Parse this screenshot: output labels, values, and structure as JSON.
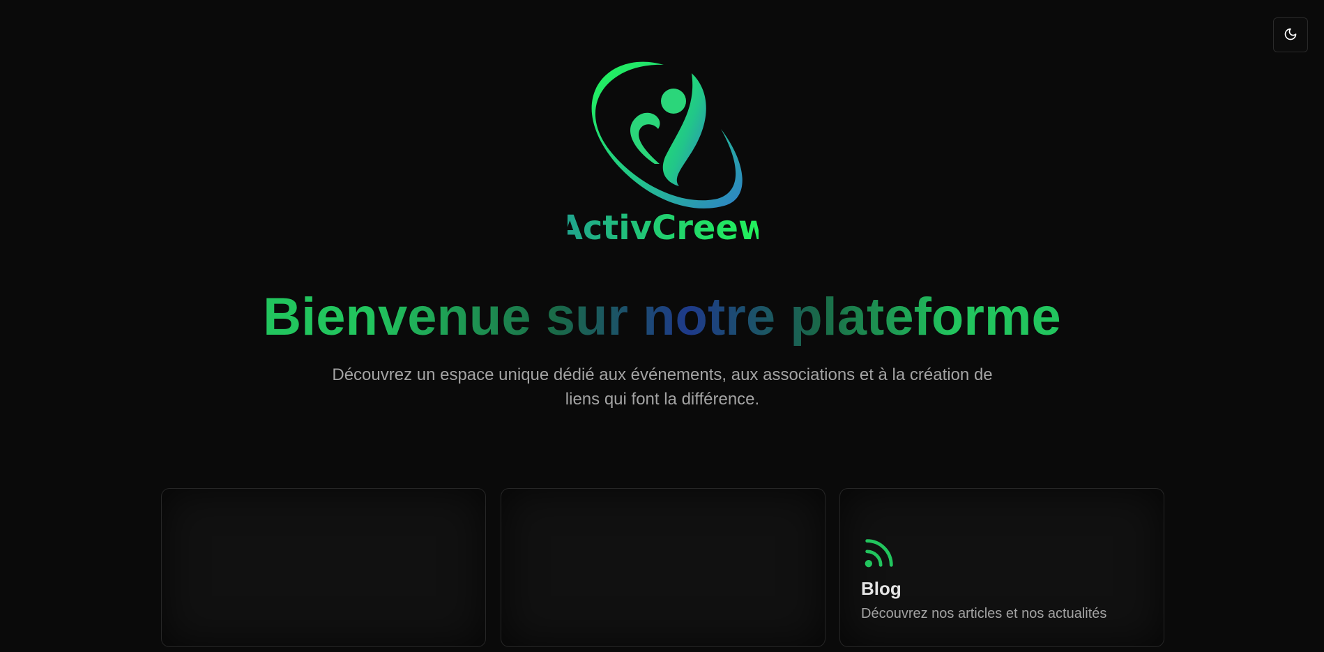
{
  "theme_toggle": {
    "icon": "moon-icon",
    "color": "#ffffff"
  },
  "logo": {
    "wordmark": "ActivCreew",
    "primary_color": "#22c55e",
    "secondary_color": "#2f80c8"
  },
  "hero": {
    "title": "Bienvenue sur notre plateforme",
    "subtitle": "Découvrez un espace unique dédié aux événements, aux associations et à la création de liens qui font la différence."
  },
  "cards": [
    {
      "title": "",
      "description": ""
    },
    {
      "title": "",
      "description": ""
    },
    {
      "icon": "rss-icon",
      "icon_color": "#22c55e",
      "title": "Blog",
      "description": "Découvrez nos articles et nos actualités"
    }
  ],
  "colors": {
    "background": "#0a0a0a",
    "accent": "#22c55e",
    "card_background": "#111111",
    "card_border": "#262626",
    "muted_text": "#a3a3a3"
  }
}
